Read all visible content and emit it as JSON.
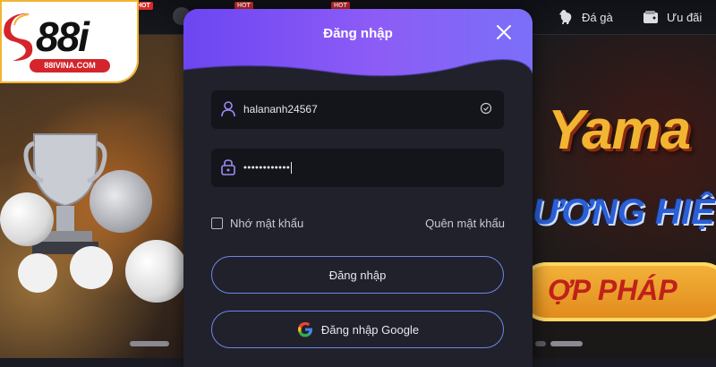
{
  "logo": {
    "text": "88i",
    "site": "88IVINA.COM"
  },
  "nav": {
    "hot_badge": "HOT",
    "items": [
      {
        "label": "Đá gà",
        "icon": "rooster-icon"
      },
      {
        "label": "Ưu đãi",
        "icon": "wallet-icon"
      }
    ]
  },
  "promo": {
    "line1": "Yama",
    "line2": "ƯƠNG HIỆ",
    "line3": "ỢP PHÁP"
  },
  "modal": {
    "title": "Đăng nhập",
    "username": {
      "value": "halananh24567",
      "icon": "user-icon",
      "status_icon": "check-circle-icon"
    },
    "password": {
      "value": "••••••••••••",
      "icon": "lock-icon"
    },
    "remember_label": "Nhớ mật khẩu",
    "forgot_label": "Quên mật khẩu",
    "login_button": "Đăng nhập",
    "google_button": "Đăng nhập Google"
  },
  "colors": {
    "header_gradient_start": "#6c46f2",
    "header_gradient_end": "#7b6ff8",
    "modal_bg": "#20212a",
    "field_bg": "#14151b",
    "button_border": "#6f86e8"
  }
}
